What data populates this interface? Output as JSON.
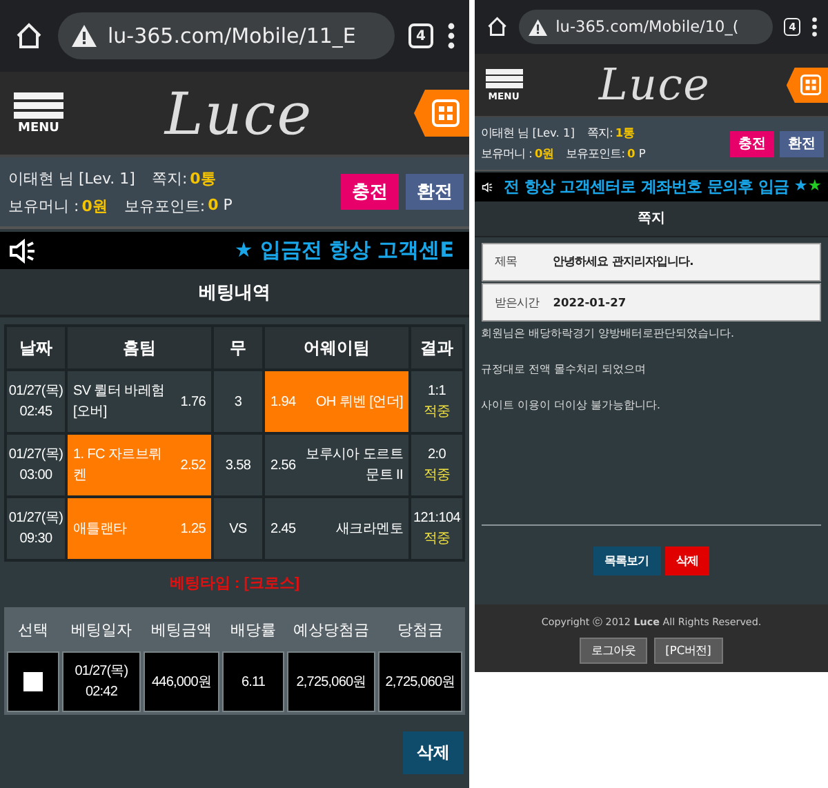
{
  "screens": [
    {
      "kind": "bets",
      "browser": {
        "url": "lu-365.com/Mobile/11_E",
        "tab_count": "4"
      },
      "header": {
        "menu_label": "MENU",
        "logo": "Luce"
      },
      "user": {
        "name": "이태현 님 [Lev. 1]",
        "messages_label": "쪽지:",
        "messages": "0통",
        "money_label": "보유머니 :",
        "money": "0원",
        "points_label": "보유포인트:",
        "points": "0 P",
        "charge": "충전",
        "exchange": "환전"
      },
      "notice": [
        {
          "kind": "star",
          "char": "★",
          "color": "#19a6e8"
        },
        {
          "kind": "text",
          "text": "입금전 항상 고객센E"
        }
      ],
      "title": "베팅내역",
      "games": {
        "columns": [
          "날짜",
          "홈팀",
          "무",
          "어웨이팀",
          "결과"
        ],
        "rows": [
          {
            "date": "01/27(목)",
            "time": "02:45",
            "home": "SV 륄터 바레험 [오버]",
            "home_odds": "1.76",
            "home_selected": false,
            "draw": "3",
            "away_odds": "1.94",
            "away": "OH 뤼벤 [언더]",
            "away_selected": true,
            "score": "1:1",
            "result": "적중"
          },
          {
            "date": "01/27(목)",
            "time": "03:00",
            "home": "1. FC 자르브뤼켄",
            "home_odds": "2.52",
            "home_selected": true,
            "draw": "3.58",
            "away_odds": "2.56",
            "away": "보루시아 도르트문트 II",
            "away_selected": false,
            "score": "2:0",
            "result": "적중"
          },
          {
            "date": "01/27(목)",
            "time": "09:30",
            "home": "애틀랜타",
            "home_odds": "1.25",
            "home_selected": true,
            "draw": "VS",
            "away_odds": "2.45",
            "away": "새크라멘토",
            "away_selected": false,
            "score": "121:104",
            "result": "적중"
          }
        ]
      },
      "bet_type": "베팅타입 : [크로스]",
      "summary": {
        "columns": [
          "선택",
          "베팅일자",
          "베팅금액",
          "배당률",
          "예상당첨금",
          "당첨금"
        ],
        "rows": [
          {
            "checked": false,
            "date": "01/27(목)",
            "time": "02:42",
            "amount": "446,000원",
            "odds": "6.11",
            "expected": "2,725,060원",
            "win": "2,725,060원"
          }
        ]
      },
      "delete": "삭제"
    },
    {
      "kind": "message",
      "browser": {
        "url": "lu-365.com/Mobile/10_(",
        "tab_count": "4"
      },
      "header": {
        "menu_label": "MENU",
        "logo": "Luce"
      },
      "user": {
        "name": "이태현 님 [Lev. 1]",
        "messages_label": "쪽지:",
        "messages": "1통",
        "money_label": "보유머니 :",
        "money": "0원",
        "points_label": "보유포인트:",
        "points": "0 P",
        "charge": "충전",
        "exchange": "환전"
      },
      "notice": [
        {
          "kind": "text",
          "text": "전 항상 고객센터로 계좌번호 문의후 입금"
        },
        {
          "kind": "star",
          "char": "★",
          "color": "#19a6e8"
        },
        {
          "kind": "star",
          "char": "★",
          "color": "#22cc22"
        }
      ],
      "title": "쪽지",
      "fields": [
        {
          "label": "제목",
          "value": "안녕하세요 관지리자입니다."
        },
        {
          "label": "받은시간",
          "value": "2022-01-27"
        }
      ],
      "body": [
        "회원님은 배당하락경기 양방배터로판단되었습니다.",
        "규정대로 전액 몰수처리 되었으며",
        "사이트 이용이 더이상 불가능합니다."
      ],
      "buttons": [
        {
          "label": "목록보기",
          "kind": "list"
        },
        {
          "label": "삭제",
          "kind": "delete"
        }
      ],
      "footer": {
        "copyright": "Copyright ⓒ 2012 **Luce** All Rights Reserved.",
        "buttons": [
          "로그아웃",
          "[PC버전]"
        ]
      }
    }
  ]
}
